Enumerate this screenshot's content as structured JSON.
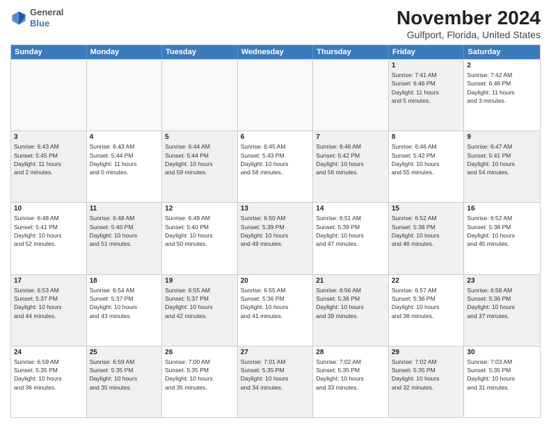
{
  "header": {
    "logo_line1": "General",
    "logo_line2": "Blue",
    "title": "November 2024",
    "subtitle": "Gulfport, Florida, United States"
  },
  "calendar": {
    "days_of_week": [
      "Sunday",
      "Monday",
      "Tuesday",
      "Wednesday",
      "Thursday",
      "Friday",
      "Saturday"
    ],
    "rows": [
      [
        {
          "day": "",
          "info": "",
          "empty": true
        },
        {
          "day": "",
          "info": "",
          "empty": true
        },
        {
          "day": "",
          "info": "",
          "empty": true
        },
        {
          "day": "",
          "info": "",
          "empty": true
        },
        {
          "day": "",
          "info": "",
          "empty": true
        },
        {
          "day": "1",
          "info": "Sunrise: 7:41 AM\nSunset: 6:46 PM\nDaylight: 11 hours\nand 5 minutes.",
          "shaded": true
        },
        {
          "day": "2",
          "info": "Sunrise: 7:42 AM\nSunset: 6:46 PM\nDaylight: 11 hours\nand 3 minutes.",
          "shaded": false
        }
      ],
      [
        {
          "day": "3",
          "info": "Sunrise: 6:43 AM\nSunset: 5:45 PM\nDaylight: 11 hours\nand 2 minutes.",
          "shaded": true
        },
        {
          "day": "4",
          "info": "Sunrise: 6:43 AM\nSunset: 5:44 PM\nDaylight: 11 hours\nand 0 minutes.",
          "shaded": false
        },
        {
          "day": "5",
          "info": "Sunrise: 6:44 AM\nSunset: 5:44 PM\nDaylight: 10 hours\nand 59 minutes.",
          "shaded": true
        },
        {
          "day": "6",
          "info": "Sunrise: 6:45 AM\nSunset: 5:43 PM\nDaylight: 10 hours\nand 58 minutes.",
          "shaded": false
        },
        {
          "day": "7",
          "info": "Sunrise: 6:46 AM\nSunset: 5:42 PM\nDaylight: 10 hours\nand 56 minutes.",
          "shaded": true
        },
        {
          "day": "8",
          "info": "Sunrise: 6:46 AM\nSunset: 5:42 PM\nDaylight: 10 hours\nand 55 minutes.",
          "shaded": false
        },
        {
          "day": "9",
          "info": "Sunrise: 6:47 AM\nSunset: 5:41 PM\nDaylight: 10 hours\nand 54 minutes.",
          "shaded": true
        }
      ],
      [
        {
          "day": "10",
          "info": "Sunrise: 6:48 AM\nSunset: 5:41 PM\nDaylight: 10 hours\nand 52 minutes.",
          "shaded": false
        },
        {
          "day": "11",
          "info": "Sunrise: 6:48 AM\nSunset: 5:40 PM\nDaylight: 10 hours\nand 51 minutes.",
          "shaded": true
        },
        {
          "day": "12",
          "info": "Sunrise: 6:49 AM\nSunset: 5:40 PM\nDaylight: 10 hours\nand 50 minutes.",
          "shaded": false
        },
        {
          "day": "13",
          "info": "Sunrise: 6:50 AM\nSunset: 5:39 PM\nDaylight: 10 hours\nand 49 minutes.",
          "shaded": true
        },
        {
          "day": "14",
          "info": "Sunrise: 6:51 AM\nSunset: 5:39 PM\nDaylight: 10 hours\nand 47 minutes.",
          "shaded": false
        },
        {
          "day": "15",
          "info": "Sunrise: 6:52 AM\nSunset: 5:38 PM\nDaylight: 10 hours\nand 46 minutes.",
          "shaded": true
        },
        {
          "day": "16",
          "info": "Sunrise: 6:52 AM\nSunset: 5:38 PM\nDaylight: 10 hours\nand 45 minutes.",
          "shaded": false
        }
      ],
      [
        {
          "day": "17",
          "info": "Sunrise: 6:53 AM\nSunset: 5:37 PM\nDaylight: 10 hours\nand 44 minutes.",
          "shaded": true
        },
        {
          "day": "18",
          "info": "Sunrise: 6:54 AM\nSunset: 5:37 PM\nDaylight: 10 hours\nand 43 minutes.",
          "shaded": false
        },
        {
          "day": "19",
          "info": "Sunrise: 6:55 AM\nSunset: 5:37 PM\nDaylight: 10 hours\nand 42 minutes.",
          "shaded": true
        },
        {
          "day": "20",
          "info": "Sunrise: 6:55 AM\nSunset: 5:36 PM\nDaylight: 10 hours\nand 41 minutes.",
          "shaded": false
        },
        {
          "day": "21",
          "info": "Sunrise: 6:56 AM\nSunset: 5:36 PM\nDaylight: 10 hours\nand 39 minutes.",
          "shaded": true
        },
        {
          "day": "22",
          "info": "Sunrise: 6:57 AM\nSunset: 5:36 PM\nDaylight: 10 hours\nand 38 minutes.",
          "shaded": false
        },
        {
          "day": "23",
          "info": "Sunrise: 6:58 AM\nSunset: 5:36 PM\nDaylight: 10 hours\nand 37 minutes.",
          "shaded": true
        }
      ],
      [
        {
          "day": "24",
          "info": "Sunrise: 6:59 AM\nSunset: 5:35 PM\nDaylight: 10 hours\nand 36 minutes.",
          "shaded": false
        },
        {
          "day": "25",
          "info": "Sunrise: 6:59 AM\nSunset: 5:35 PM\nDaylight: 10 hours\nand 35 minutes.",
          "shaded": true
        },
        {
          "day": "26",
          "info": "Sunrise: 7:00 AM\nSunset: 5:35 PM\nDaylight: 10 hours\nand 35 minutes.",
          "shaded": false
        },
        {
          "day": "27",
          "info": "Sunrise: 7:01 AM\nSunset: 5:35 PM\nDaylight: 10 hours\nand 34 minutes.",
          "shaded": true
        },
        {
          "day": "28",
          "info": "Sunrise: 7:02 AM\nSunset: 5:35 PM\nDaylight: 10 hours\nand 33 minutes.",
          "shaded": false
        },
        {
          "day": "29",
          "info": "Sunrise: 7:02 AM\nSunset: 5:35 PM\nDaylight: 10 hours\nand 32 minutes.",
          "shaded": true
        },
        {
          "day": "30",
          "info": "Sunrise: 7:03 AM\nSunset: 5:35 PM\nDaylight: 10 hours\nand 31 minutes.",
          "shaded": false
        }
      ]
    ]
  }
}
